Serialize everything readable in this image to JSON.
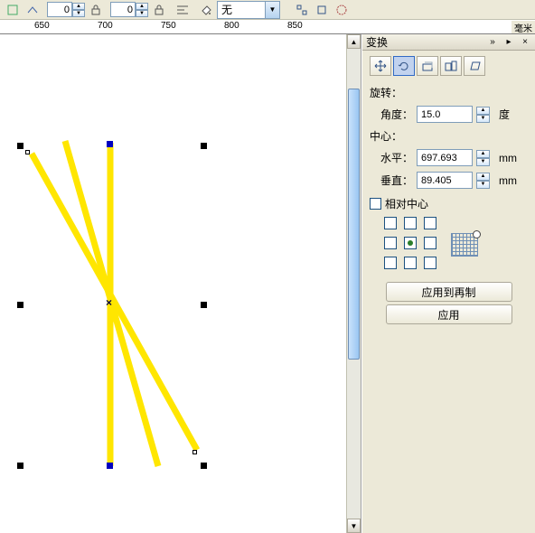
{
  "toolbar": {
    "spinner1": "0",
    "spinner2": "0",
    "fill_label": "无"
  },
  "ruler": {
    "ticks": [
      650,
      700,
      750,
      800,
      850
    ],
    "unit": "毫米"
  },
  "panel": {
    "title": "变换",
    "rotate_section": "旋转：",
    "angle_label": "角度：",
    "angle_value": "15.0",
    "angle_unit": "度",
    "center_section": "中心：",
    "horizontal_label": "水平：",
    "horizontal_value": "697.693",
    "vertical_label": "垂直：",
    "vertical_value": "89.405",
    "mm_unit": "mm",
    "relative_center": "相对中心",
    "apply_copy": "应用到再制",
    "apply": "应用"
  },
  "header_icons": {
    "chev": "»",
    "menu": "▸",
    "close": "×"
  }
}
